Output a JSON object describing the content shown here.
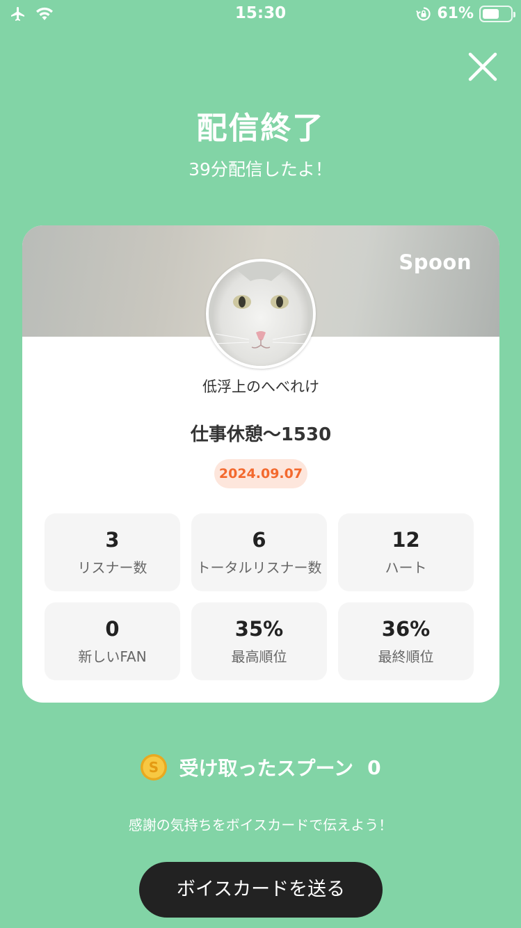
{
  "status_bar": {
    "time": "15:30",
    "battery_percent_label": "61%",
    "battery_level": 0.61,
    "icons": [
      "airplane-icon",
      "wifi-icon",
      "rotation-lock-icon",
      "battery-icon"
    ]
  },
  "header": {
    "title": "配信終了",
    "subtitle": "39分配信したよ！"
  },
  "card": {
    "brand": "Spoon",
    "username": "低浮上のへべれけ",
    "live_title": "仕事休憩〜1530",
    "date": "2024.09.07",
    "stats": [
      {
        "value": "3",
        "label": "リスナー数"
      },
      {
        "value": "6",
        "label": "トータルリスナー数"
      },
      {
        "value": "12",
        "label": "ハート"
      },
      {
        "value": "0",
        "label": "新しいFAN"
      },
      {
        "value": "35%",
        "label": "最高順位"
      },
      {
        "value": "36%",
        "label": "最終順位"
      }
    ]
  },
  "spoons": {
    "label": "受け取ったスプーン",
    "count": "0"
  },
  "hint": "感謝の気持ちをボイスカードで伝えよう！",
  "send_button_label": "ボイスカードを送る",
  "colors": {
    "background": "#82d4a6",
    "date_badge_bg": "#fde6dc",
    "date_badge_text": "#f3692e",
    "button_bg": "#222222",
    "coin": "#f5c242"
  }
}
